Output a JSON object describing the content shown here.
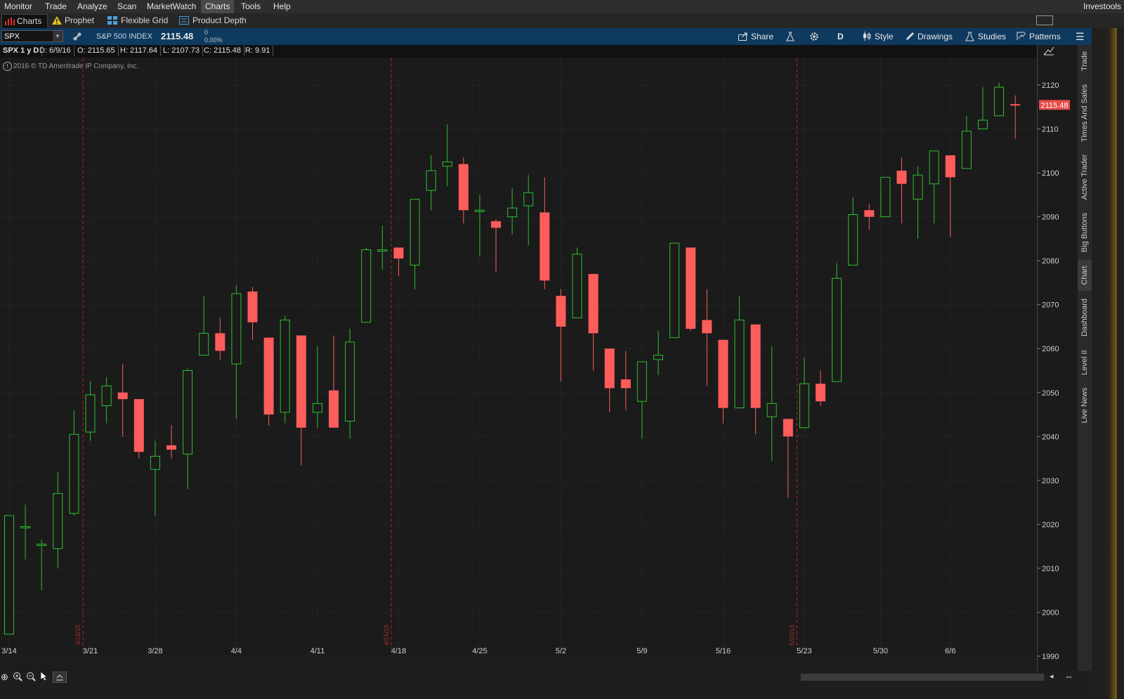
{
  "menu": {
    "items": [
      "Monitor",
      "Trade",
      "Analyze",
      "Scan",
      "MarketWatch",
      "Charts",
      "Tools",
      "Help"
    ],
    "active": "Charts",
    "right_label": "Investools"
  },
  "subbar": {
    "charts_tab": "Charts",
    "prophet": "Prophet",
    "flexible_grid": "Flexible Grid",
    "product_depth": "Product Depth"
  },
  "symbol_bar": {
    "symbol": "SPX",
    "description": "S&P 500 INDEX",
    "last": "2115.48",
    "change": "0",
    "change_pct": "0.00%",
    "share": "Share",
    "period": "D",
    "style": "Style",
    "drawings": "Drawings",
    "studies": "Studies",
    "patterns": "Patterns"
  },
  "info_bar": {
    "title": "SPX 1 y D",
    "date": "D: 6/9/16",
    "open": "O: 2115.65",
    "high": "H: 2117.64",
    "low": "L: 2107.73",
    "close": "C: 2115.48",
    "range": "R: 9.91"
  },
  "copyright": "2016 © TD Ameritrade IP Company, Inc.",
  "side_tabs": [
    "Trade",
    "Times And Sales",
    "Active Trader",
    "Big Buttons",
    "Chart",
    "Dashboard",
    "Level II",
    "Live News"
  ],
  "active_side_tab": "Chart",
  "colors": {
    "up": "#2fbf2f",
    "down": "#ff5c5c",
    "price_tag": "#e84a4a",
    "month_line": "#b02020",
    "toolbar_blue": "#0f3a5f"
  },
  "price_tag": "2115.48",
  "chart_data": {
    "type": "candlestick",
    "ylim": [
      1990,
      2125
    ],
    "y_ticks": [
      2120,
      2110,
      2100,
      2090,
      2080,
      2070,
      2060,
      2050,
      2040,
      2030,
      2020,
      2010,
      2000,
      1990
    ],
    "x_tick_labels": [
      "3/14",
      "3/21",
      "3/28",
      "4/4",
      "4/11",
      "4/18",
      "4/25",
      "5/2",
      "5/9",
      "5/16",
      "5/23",
      "5/30",
      "6/6"
    ],
    "month_markers": [
      "3/18/16",
      "4/15/16",
      "5/20/16"
    ],
    "candles": [
      {
        "d": "3/14",
        "o": 1995,
        "h": 2022,
        "l": 1995,
        "c": 2022
      },
      {
        "d": "3/15",
        "o": 2019.5,
        "h": 2024.5,
        "l": 2012,
        "c": 2019.5
      },
      {
        "d": "3/16",
        "o": 2015.5,
        "h": 2016.5,
        "l": 2005,
        "c": 2015.5
      },
      {
        "d": "3/17",
        "o": 2014.5,
        "h": 2032,
        "l": 2010,
        "c": 2027
      },
      {
        "d": "3/18",
        "o": 2022.5,
        "h": 2046,
        "l": 2022,
        "c": 2040.5
      },
      {
        "d": "3/21",
        "o": 2041,
        "h": 2052.5,
        "l": 2039,
        "c": 2049.5
      },
      {
        "d": "3/22",
        "o": 2047,
        "h": 2053.5,
        "l": 2043,
        "c": 2051.5
      },
      {
        "d": "3/23",
        "o": 2050,
        "h": 2056.5,
        "l": 2040,
        "c": 2048.5
      },
      {
        "d": "3/24",
        "o": 2048.5,
        "h": 2048.5,
        "l": 2035,
        "c": 2036.5
      },
      {
        "d": "3/28",
        "o": 2032.5,
        "h": 2039,
        "l": 2022,
        "c": 2035.5
      },
      {
        "d": "3/29",
        "o": 2038,
        "h": 2042.5,
        "l": 2035,
        "c": 2037
      },
      {
        "d": "3/30",
        "o": 2036,
        "h": 2055.5,
        "l": 2028,
        "c": 2055
      },
      {
        "d": "3/31",
        "o": 2058.5,
        "h": 2072,
        "l": 2058.5,
        "c": 2063.5
      },
      {
        "d": "4/1",
        "o": 2063.5,
        "h": 2067,
        "l": 2057.5,
        "c": 2059.5
      },
      {
        "d": "4/4",
        "o": 2056.5,
        "h": 2074.5,
        "l": 2044,
        "c": 2072.5
      },
      {
        "d": "4/5",
        "o": 2073,
        "h": 2074,
        "l": 2062,
        "c": 2066
      },
      {
        "d": "4/6",
        "o": 2062.5,
        "h": 2062.5,
        "l": 2042.5,
        "c": 2045
      },
      {
        "d": "4/7",
        "o": 2045.5,
        "h": 2067.5,
        "l": 2043,
        "c": 2066.5
      },
      {
        "d": "4/8",
        "o": 2063,
        "h": 2063,
        "l": 2033.5,
        "c": 2042
      },
      {
        "d": "4/11",
        "o": 2045.5,
        "h": 2060.5,
        "l": 2042,
        "c": 2047.5
      },
      {
        "d": "4/12",
        "o": 2050.5,
        "h": 2063,
        "l": 2042,
        "c": 2042
      },
      {
        "d": "4/13",
        "o": 2043.5,
        "h": 2064.5,
        "l": 2039.5,
        "c": 2061.5
      },
      {
        "d": "4/14",
        "o": 2066,
        "h": 2083,
        "l": 2066,
        "c": 2082.5
      },
      {
        "d": "4/15",
        "o": 2082.5,
        "h": 2088,
        "l": 2078,
        "c": 2082.5
      },
      {
        "d": "4/18",
        "o": 2083,
        "h": 2083,
        "l": 2076.5,
        "c": 2080.5
      },
      {
        "d": "4/19",
        "o": 2079,
        "h": 2094,
        "l": 2073.5,
        "c": 2094
      },
      {
        "d": "4/20",
        "o": 2096,
        "h": 2104,
        "l": 2091.5,
        "c": 2100.5
      },
      {
        "d": "4/21",
        "o": 2101.5,
        "h": 2111,
        "l": 2097,
        "c": 2102.5
      },
      {
        "d": "4/22",
        "o": 2102,
        "h": 2103.5,
        "l": 2088.5,
        "c": 2091.5
      },
      {
        "d": "4/25",
        "o": 2091.5,
        "h": 2095,
        "l": 2081,
        "c": 2091.5
      },
      {
        "d": "4/26",
        "o": 2089,
        "h": 2089.5,
        "l": 2077.5,
        "c": 2087.5
      },
      {
        "d": "4/27",
        "o": 2090,
        "h": 2096.5,
        "l": 2086,
        "c": 2092
      },
      {
        "d": "4/28",
        "o": 2092.5,
        "h": 2099.5,
        "l": 2083.5,
        "c": 2095.5
      },
      {
        "d": "4/29",
        "o": 2091,
        "h": 2099,
        "l": 2073.5,
        "c": 2075.5
      },
      {
        "d": "5/2",
        "o": 2072,
        "h": 2073.5,
        "l": 2052.5,
        "c": 2065
      },
      {
        "d": "5/3",
        "o": 2067,
        "h": 2083,
        "l": 2067,
        "c": 2081.5
      },
      {
        "d": "5/4",
        "o": 2077,
        "h": 2077,
        "l": 2055,
        "c": 2063.5
      },
      {
        "d": "5/5",
        "o": 2060,
        "h": 2060,
        "l": 2045.5,
        "c": 2051
      },
      {
        "d": "5/6",
        "o": 2053,
        "h": 2059.5,
        "l": 2046,
        "c": 2051
      },
      {
        "d": "5/9",
        "o": 2048,
        "h": 2057,
        "l": 2039.5,
        "c": 2057
      },
      {
        "d": "5/10",
        "o": 2057.5,
        "h": 2064,
        "l": 2054,
        "c": 2058.5
      },
      {
        "d": "5/11",
        "o": 2062.5,
        "h": 2084,
        "l": 2062.5,
        "c": 2084
      },
      {
        "d": "5/12",
        "o": 2083,
        "h": 2083,
        "l": 2064,
        "c": 2064.5
      },
      {
        "d": "5/13",
        "o": 2066.5,
        "h": 2073.5,
        "l": 2051.5,
        "c": 2063.5
      },
      {
        "d": "5/16",
        "o": 2062,
        "h": 2062,
        "l": 2043,
        "c": 2046.5
      },
      {
        "d": "5/17",
        "o": 2046.5,
        "h": 2072,
        "l": 2046.5,
        "c": 2066.5
      },
      {
        "d": "5/18",
        "o": 2065.5,
        "h": 2065.5,
        "l": 2040.5,
        "c": 2046.5
      },
      {
        "d": "5/19",
        "o": 2044.5,
        "h": 2060.5,
        "l": 2034.5,
        "c": 2047.5
      },
      {
        "d": "5/20",
        "o": 2044,
        "h": 2044,
        "l": 2026,
        "c": 2040
      },
      {
        "d": "5/23",
        "o": 2042,
        "h": 2058,
        "l": 2042,
        "c": 2052
      },
      {
        "d": "5/24",
        "o": 2052,
        "h": 2055,
        "l": 2047,
        "c": 2048
      },
      {
        "d": "5/25",
        "o": 2052.5,
        "h": 2079.5,
        "l": 2052.5,
        "c": 2076
      },
      {
        "d": "5/26",
        "o": 2079,
        "h": 2094.5,
        "l": 2079,
        "c": 2090.5
      },
      {
        "d": "5/27",
        "o": 2091.5,
        "h": 2093,
        "l": 2087,
        "c": 2090
      },
      {
        "d": "5/31",
        "o": 2090,
        "h": 2099,
        "l": 2090,
        "c": 2099
      },
      {
        "d": "6/1",
        "o": 2100.5,
        "h": 2103.5,
        "l": 2088.5,
        "c": 2097.5
      },
      {
        "d": "6/2",
        "o": 2094,
        "h": 2101.5,
        "l": 2085,
        "c": 2099.5
      },
      {
        "d": "6/3",
        "o": 2097.5,
        "h": 2105,
        "l": 2088.5,
        "c": 2105
      },
      {
        "d": "6/6",
        "o": 2104,
        "h": 2104,
        "l": 2085.5,
        "c": 2099
      },
      {
        "d": "6/7",
        "o": 2101,
        "h": 2113,
        "l": 2101,
        "c": 2109.5
      },
      {
        "d": "6/8",
        "o": 2110,
        "h": 2119.5,
        "l": 2110,
        "c": 2112
      },
      {
        "d": "6/9",
        "o": 2113,
        "h": 2120.5,
        "l": 2113,
        "c": 2119.5
      },
      {
        "d": "6/10",
        "o": 2115.65,
        "h": 2117.64,
        "l": 2107.73,
        "c": 2115.48
      }
    ]
  }
}
